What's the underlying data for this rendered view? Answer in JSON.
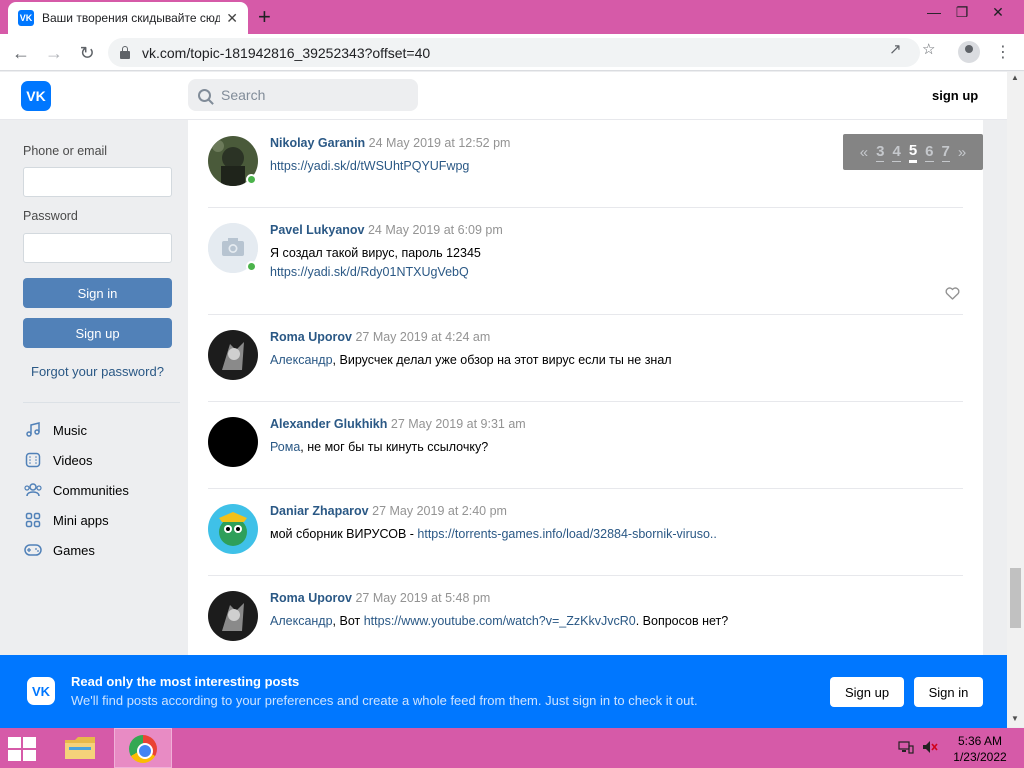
{
  "browser": {
    "tab_title": "Ваши творения скидывайте сюда",
    "new_tab": "+",
    "url": "vk.com/topic-181942816_39252343?offset=40",
    "window_controls": {
      "minimize": "—",
      "restore": "❐",
      "close": "✕"
    }
  },
  "header": {
    "logo": "VK",
    "search_placeholder": "Search",
    "signup": "sign up"
  },
  "login": {
    "phone_label": "Phone or email",
    "password_label": "Password",
    "signin": "Sign in",
    "signup": "Sign up",
    "forgot": "Forgot your password?"
  },
  "nav": [
    {
      "label": "Music",
      "icon": "music-icon"
    },
    {
      "label": "Videos",
      "icon": "video-icon"
    },
    {
      "label": "Communities",
      "icon": "communities-icon"
    },
    {
      "label": "Mini apps",
      "icon": "mini-apps-icon"
    },
    {
      "label": "Games",
      "icon": "games-icon"
    }
  ],
  "pager": {
    "prev": "«",
    "pages": [
      "3",
      "4",
      "5",
      "6",
      "7"
    ],
    "current": "5",
    "next": "»"
  },
  "posts": [
    {
      "author": "Nikolay Garanin",
      "date": "24 May 2019 at 12:52 pm",
      "lines": [
        {
          "text": "",
          "link": "https://yadi.sk/d/tWSUhtPQYUFwpg"
        }
      ],
      "online": true
    },
    {
      "author": "Pavel Lukyanov",
      "date": "24 May 2019 at 6:09 pm",
      "lines": [
        {
          "text": "Я создал такой вирус, пароль 12345",
          "link": ""
        },
        {
          "text": "",
          "link": "https://yadi.sk/d/Rdy01NTXUgVebQ"
        }
      ],
      "online": true
    },
    {
      "author": "Roma Uporov",
      "date": "27 May 2019 at 4:24 am",
      "reply_to": "Александр",
      "text": ", Вирусчек делал уже обзор на этот вирус если ты не знал"
    },
    {
      "author": "Alexander Glukhikh",
      "date": "27 May 2019 at 9:31 am",
      "reply_to": "Рома",
      "text": ", не мог бы ты кинуть ссылочку?"
    },
    {
      "author": "Daniar Zhaparov",
      "date": "27 May 2019 at 2:40 pm",
      "text": "мой сборник ВИРУСОВ - ",
      "link": "https://torrents-games.info/load/32884-sbornik-viruso.."
    },
    {
      "author": "Roma Uporov",
      "date": "27 May 2019 at 5:48 pm",
      "reply_to": "Александр",
      "text": ", Вот ",
      "link": "https://www.youtube.com/watch?v=_ZzKkvJvcR0",
      "tail": ". Вопросов нет?"
    }
  ],
  "banner": {
    "logo": "VK",
    "title": "Read only the most interesting posts",
    "subtitle": "We'll find posts according to your preferences and create a whole feed from them. Just sign in to check it out.",
    "signup": "Sign up",
    "signin": "Sign in"
  },
  "taskbar": {
    "time": "5:36 AM",
    "date": "1/23/2022"
  },
  "colors": {
    "vk_blue": "#0077ff",
    "button_blue": "#5181b8",
    "link": "#2a5885",
    "taskbar": "#d65aa8"
  }
}
